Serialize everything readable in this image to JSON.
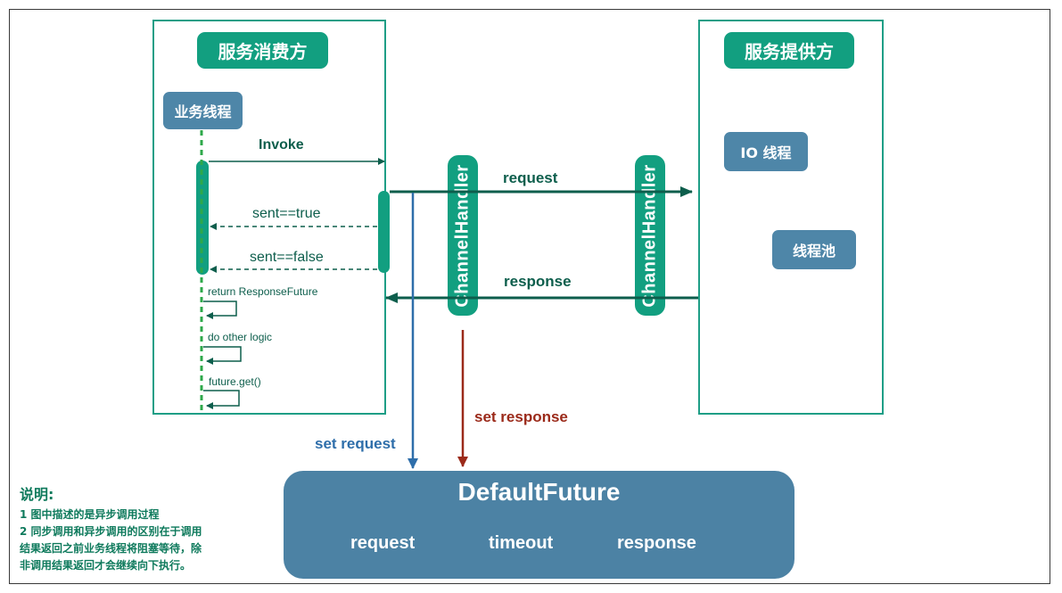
{
  "consumer": {
    "title": "服务消费方",
    "thread": "业务线程"
  },
  "provider": {
    "title": "服务提供方",
    "io_thread": "IO 线程",
    "pool": "线程池"
  },
  "handler": {
    "label": "ChannelHandler"
  },
  "messages": {
    "invoke": "Invoke",
    "sent_true": "sent==true",
    "sent_false": "sent==false",
    "return_future": "return ResponseFuture",
    "other_logic": "do other logic",
    "future_get": "future.get()",
    "request": "request",
    "response": "response",
    "set_request": "set request",
    "set_response": "set response"
  },
  "future": {
    "title": "DefaultFuture",
    "fields": [
      "request",
      "timeout",
      "response"
    ]
  },
  "note": {
    "heading": "说明:",
    "lines": [
      "1 图中描述的是异步调用过程",
      "2 同步调用和异步调用的区别在于调用",
      "结果返回之前业务线程将阻塞等待，除",
      "非调用结果返回才会继续向下执行。"
    ]
  },
  "colors": {
    "green": "#129f80",
    "arrow": "#0d5e4c",
    "blue": "#2e6eaa",
    "red": "#9b2a1a",
    "future": "#4c82a4",
    "tag": "#4e86a8"
  }
}
